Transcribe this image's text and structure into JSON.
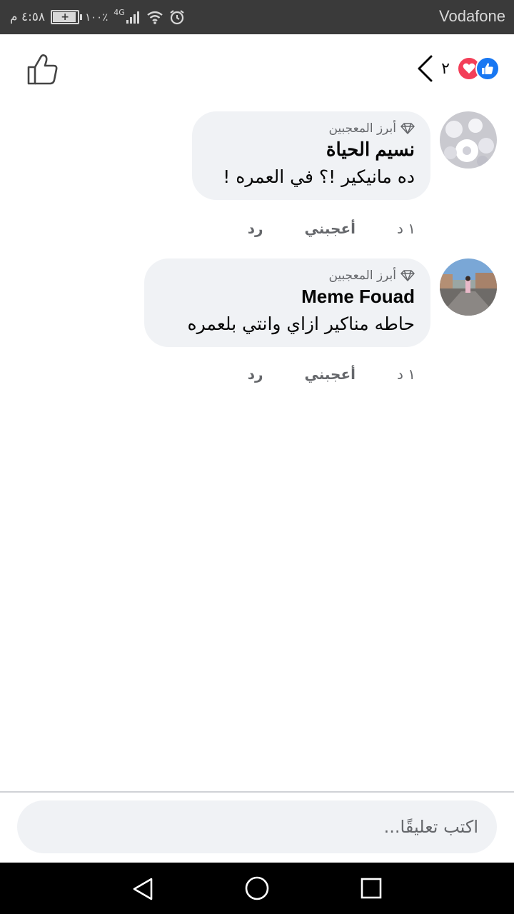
{
  "status_bar": {
    "carrier": "Vodafone",
    "time": "٤:٥٨ م",
    "battery": "١٠٠٪",
    "network": "4G",
    "battery_level": 1.0
  },
  "header": {
    "reaction_count": "٢",
    "reactions": [
      "like",
      "love"
    ],
    "colors": {
      "like": "#1877f2",
      "love": "#f33e58"
    }
  },
  "comments": [
    {
      "badge": "أبرز المعجبين",
      "name": "نسيم الحياة",
      "text": "ده مانيكير !؟ في العمره !",
      "time": "١ د",
      "like_label": "أعجبني",
      "reply_label": "رد"
    },
    {
      "badge": "أبرز المعجبين",
      "name": "Meme Fouad",
      "text": "حاطه مناكير ازاي وانتي بلعمره",
      "time": "١ د",
      "like_label": "أعجبني",
      "reply_label": "رد"
    }
  ],
  "composer": {
    "placeholder": "اكتب تعليقًا..."
  }
}
